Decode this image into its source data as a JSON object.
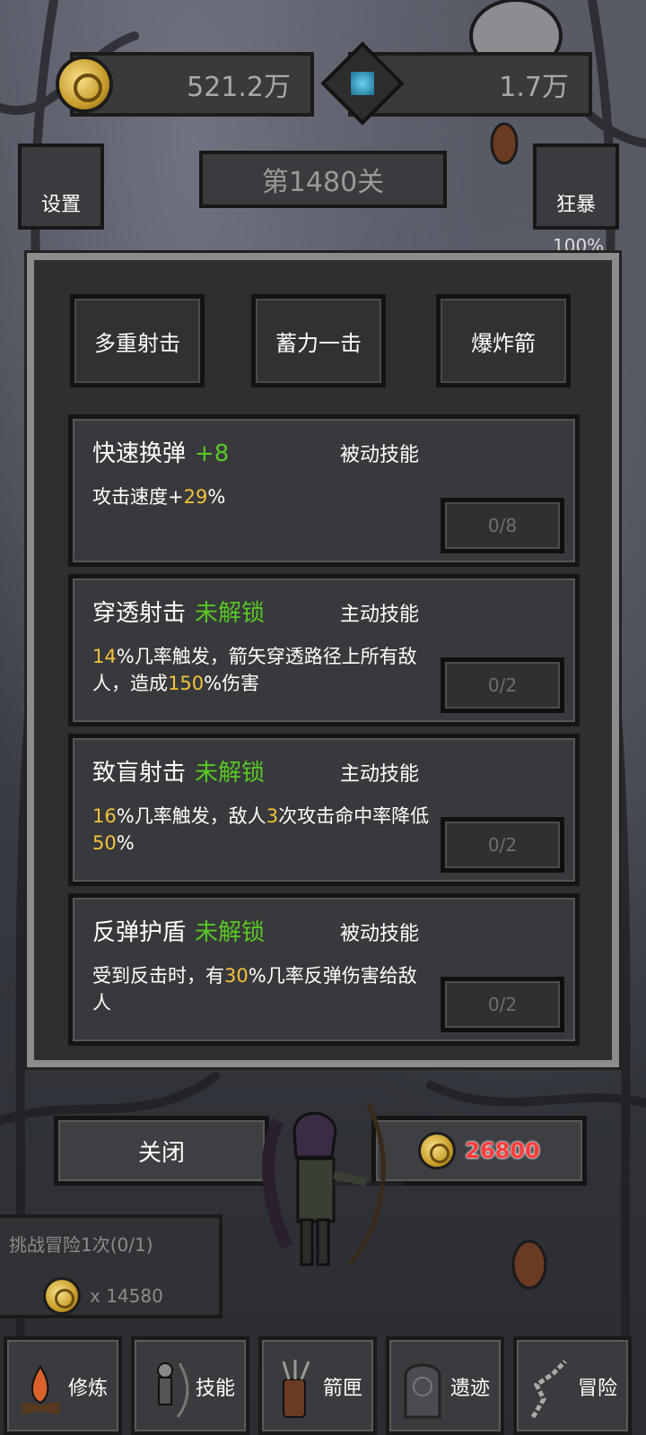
{
  "currency": {
    "gold_value": "521.2万",
    "gold_icon": "gold-coin-icon",
    "gem_value": "1.7万",
    "gem_icon": "blue-gem-icon"
  },
  "header": {
    "settings_label": "设置",
    "level_label": "第1480关",
    "rage_label": "狂暴",
    "rage_percent": "100%"
  },
  "modal": {
    "tabs": [
      {
        "label": "多重射击"
      },
      {
        "label": "蓄力一击"
      },
      {
        "label": "爆炸箭"
      }
    ],
    "skills": [
      {
        "name": "快速换弹",
        "status": "+8",
        "type": "被动技能",
        "desc_parts": [
          "攻击速度+",
          "29",
          "%"
        ],
        "progress": "0/8"
      },
      {
        "name": "穿透射击",
        "status": "未解锁",
        "type": "主动技能",
        "desc_parts": [
          "",
          "14",
          "%几率触发，箭矢穿透路径上所有敌人，造成",
          "150",
          "%伤害"
        ],
        "progress": "0/2"
      },
      {
        "name": "致盲射击",
        "status": "未解锁",
        "type": "主动技能",
        "desc_parts": [
          "",
          "16",
          "%几率触发，敌人",
          "3",
          "次攻击命中率降低",
          "50",
          "%"
        ],
        "progress": "0/2"
      },
      {
        "name": "反弹护盾",
        "status": "未解锁",
        "type": "被动技能",
        "desc_parts": [
          "受到反击时，有",
          "30",
          "%几率反弹伤害给敌人"
        ],
        "progress": "0/2"
      }
    ]
  },
  "actions": {
    "close_label": "关闭",
    "price": "26800"
  },
  "quest": {
    "title": "挑战冒险1次(0/1)",
    "reward": "x 14580"
  },
  "nav": [
    {
      "label": "修炼",
      "icon": "campfire-icon"
    },
    {
      "label": "技能",
      "icon": "archer-icon"
    },
    {
      "label": "箭匣",
      "icon": "quiver-icon"
    },
    {
      "label": "遗迹",
      "icon": "ruins-icon"
    },
    {
      "label": "冒险",
      "icon": "path-icon"
    }
  ],
  "colors": {
    "status_green": "#58c824",
    "highlight_yellow": "#f3c23a",
    "price_red": "#ff3b3b"
  }
}
